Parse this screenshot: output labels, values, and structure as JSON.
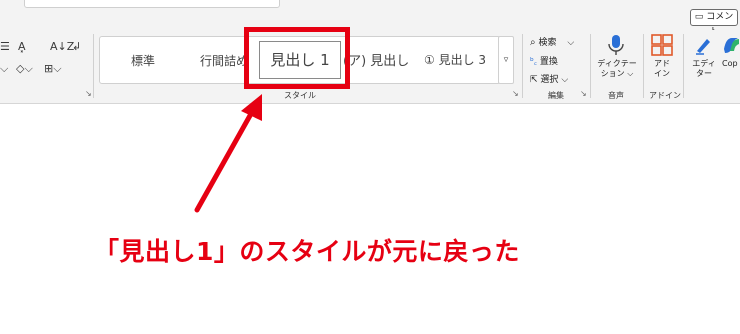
{
  "header": {
    "comment_label": "コメント"
  },
  "font_group": {
    "row1": [
      "☰",
      "A͓",
      "A↓Z",
      "↲"
    ],
    "row2": [
      "⌵",
      "◇⌵",
      "⊞⌵"
    ]
  },
  "styles": {
    "items": [
      "標準",
      "行間詰め",
      "見出し 1",
      "(ア) 見出し",
      "① 見出し 3"
    ],
    "selected": "見出し 1",
    "group_label": "スタイル",
    "more_label": "▿",
    "launcher": "↘"
  },
  "editing": {
    "search": "検索",
    "replace": "置換",
    "select": "選択",
    "group_label": "編集",
    "launcher": "↘"
  },
  "voice": {
    "dictate_line1": "ディクテー",
    "dictate_line2": "ション ⌵",
    "group_label": "音声"
  },
  "addins": {
    "label_line1": "アド",
    "label_line2": "イン",
    "group_label": "アドイン"
  },
  "editor": {
    "label_line1": "エディ",
    "label_line2": "ター"
  },
  "copilot": {
    "label": "Cop"
  },
  "annotation": {
    "caption": "「見出し1」のスタイルが元に戻った",
    "color": "#e60012"
  }
}
